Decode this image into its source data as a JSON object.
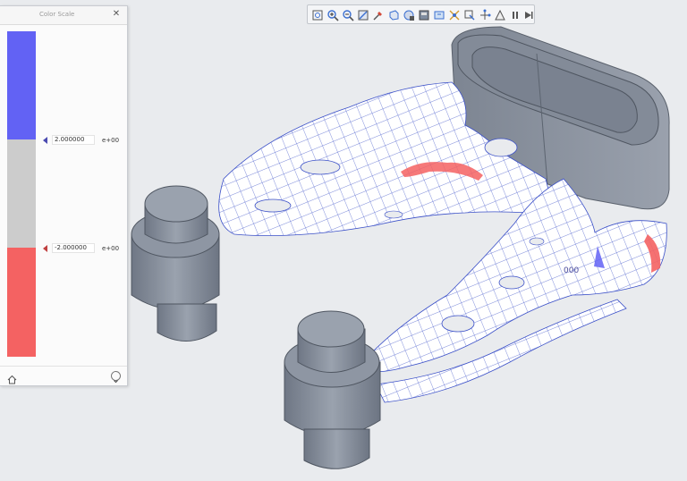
{
  "color_scale": {
    "title": "Color Scale",
    "upper_value": "2.000000",
    "upper_exponent": "e+00",
    "lower_value": "-2.000000",
    "lower_exponent": "e+00",
    "colors": {
      "above": "#6262f4",
      "within": "#cccccc",
      "below": "#f46262"
    }
  },
  "toolbar": {
    "icons": [
      "refit-icon",
      "zoom-in-icon",
      "zoom-out-icon",
      "repaint-icon",
      "named-views-icon",
      "display-style-icon",
      "view-manager-icon",
      "saved-orientations-icon",
      "perspective-icon",
      "spin-center-icon",
      "annotations-icon",
      "datum-display-icon",
      "annotation-display-icon",
      "pause-icon",
      "skip-icon"
    ]
  },
  "viewport": {
    "partial_label": "000"
  },
  "colors": {
    "model_gray": "#8e96a3",
    "surface_white": "#ffffff",
    "mesh_blue": "#3a4fc8"
  }
}
